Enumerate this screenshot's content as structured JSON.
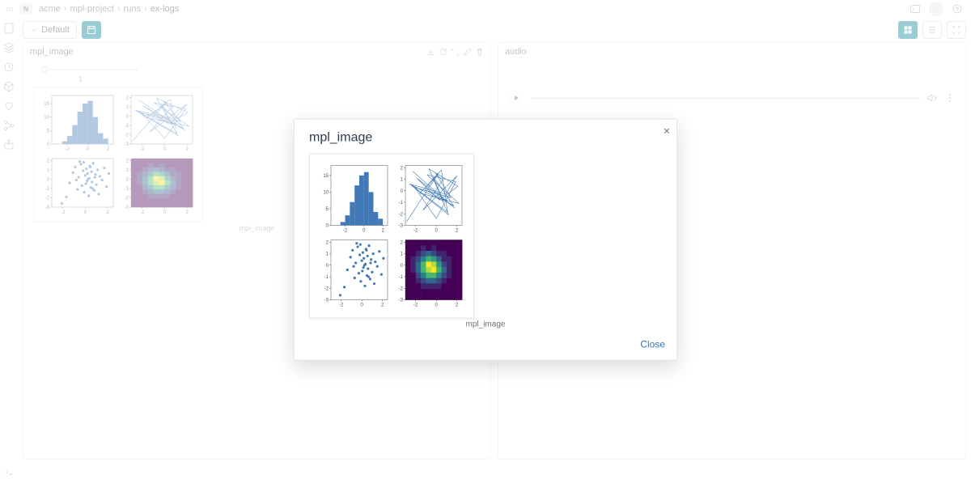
{
  "breadcrumbs": {
    "items": [
      "acme",
      "mpl-project",
      "runs"
    ],
    "current": "ex-logs",
    "badge": "N"
  },
  "toolbar": {
    "default_label": "Default"
  },
  "panels": {
    "left": {
      "title": "mpl_image",
      "caption": "mpl_image",
      "slider_tick": "1"
    },
    "right": {
      "title": "audio"
    }
  },
  "modal": {
    "title": "mpl_image",
    "caption": "mpl_image",
    "close_label": "Close"
  },
  "chart_data": [
    {
      "type": "bar",
      "title": "",
      "xlabel": "",
      "ylabel": "",
      "categories": [
        -3,
        -2.5,
        -2,
        -1.5,
        -1,
        -0.5,
        0,
        0.5,
        1,
        1.5,
        2
      ],
      "values": [
        0,
        1,
        3,
        7,
        12,
        15,
        16,
        10,
        4,
        2,
        0
      ],
      "xlim": [
        -3.5,
        2.5
      ],
      "ylim": [
        0,
        18
      ],
      "yticks": [
        0,
        5,
        10,
        15
      ],
      "xticks": [
        -2,
        0,
        2
      ]
    },
    {
      "type": "line",
      "title": "",
      "xlabel": "",
      "ylabel": "",
      "xlim": [
        -3,
        2.5
      ],
      "ylim": [
        -3,
        2.2
      ],
      "xticks": [
        -2,
        0,
        2
      ],
      "yticks": [
        -3,
        -2,
        -1,
        0,
        1,
        2
      ],
      "series": [
        {
          "name": "walk",
          "x": [
            -2.3,
            -0.4,
            1.8,
            -1.9,
            0.3,
            2.1,
            -0.7,
            1.2,
            -2.6,
            0.9,
            2.0,
            -1.3,
            0.6,
            -0.1,
            1.4,
            -2.1,
            0.0,
            1.9,
            -0.9,
            2.2,
            -1.6,
            0.5,
            1.1,
            -2.4,
            0.7,
            -0.3,
            1.7,
            -1.1,
            0.2,
            -2.9
          ],
          "y": [
            1.7,
            0.2,
            -1.5,
            1.1,
            -0.8,
            0.4,
            1.9,
            -2.1,
            0.6,
            -0.3,
            1.3,
            -1.7,
            0.9,
            1.6,
            -0.6,
            0.3,
            -2.4,
            0.8,
            1.4,
            -1.1,
            -0.2,
            1.8,
            -1.9,
            0.5,
            -0.9,
            1.2,
            -1.3,
            0.1,
            1.5,
            -2.7
          ]
        }
      ]
    },
    {
      "type": "scatter",
      "title": "",
      "xlabel": "",
      "ylabel": "",
      "xlim": [
        -3,
        2.5
      ],
      "ylim": [
        -3,
        2.2
      ],
      "xticks": [
        -2,
        0,
        2
      ],
      "yticks": [
        -3,
        -2,
        -1,
        0,
        1,
        2
      ],
      "series": [
        {
          "name": "pts",
          "x": [
            -2.1,
            -1.7,
            -1.4,
            -1.1,
            -0.9,
            -0.7,
            -0.6,
            -0.4,
            -0.3,
            -0.2,
            -0.1,
            0.0,
            0.1,
            0.15,
            0.2,
            0.3,
            0.35,
            0.4,
            0.5,
            0.55,
            0.6,
            0.7,
            0.8,
            0.9,
            1.0,
            1.1,
            1.2,
            1.3,
            1.5,
            1.7,
            1.9,
            2.1,
            -0.15,
            0.05,
            0.25,
            0.45,
            -0.5,
            -0.8,
            0.65,
            0.85
          ],
          "y": [
            -2.6,
            -1.9,
            -0.4,
            0.7,
            1.3,
            -1.1,
            0.2,
            1.6,
            -0.7,
            0.9,
            -1.4,
            0.4,
            1.1,
            -0.2,
            0.6,
            -1.8,
            0.1,
            1.4,
            -0.9,
            0.8,
            -0.3,
            1.7,
            -1.2,
            0.5,
            -0.6,
            1.0,
            -1.6,
            0.3,
            -0.1,
            1.2,
            -0.8,
            0.6,
            1.8,
            -0.5,
            0.0,
            1.3,
            1.9,
            -0.1,
            -1.0,
            0.2
          ]
        }
      ]
    },
    {
      "type": "heatmap",
      "title": "",
      "xlabel": "",
      "ylabel": "",
      "xlim": [
        -3,
        2.5
      ],
      "ylim": [
        -3,
        2.2
      ],
      "xticks": [
        -2,
        0,
        2
      ],
      "yticks": [
        -3,
        -2,
        -1,
        0,
        1,
        2
      ],
      "grid_size": 11,
      "z": [
        [
          0,
          0,
          0,
          0,
          0,
          0,
          0,
          0,
          0,
          0,
          0
        ],
        [
          0,
          0,
          0,
          1,
          0,
          1,
          0,
          0,
          0,
          0,
          0
        ],
        [
          0,
          0,
          1,
          2,
          3,
          2,
          1,
          1,
          0,
          0,
          0
        ],
        [
          0,
          1,
          2,
          4,
          6,
          5,
          3,
          1,
          1,
          0,
          0
        ],
        [
          0,
          1,
          3,
          6,
          9,
          8,
          5,
          2,
          1,
          0,
          0
        ],
        [
          0,
          1,
          3,
          6,
          8,
          9,
          6,
          3,
          1,
          0,
          0
        ],
        [
          0,
          0,
          2,
          4,
          6,
          6,
          4,
          2,
          1,
          0,
          0
        ],
        [
          0,
          0,
          1,
          2,
          3,
          3,
          2,
          1,
          0,
          0,
          0
        ],
        [
          0,
          0,
          0,
          1,
          1,
          1,
          1,
          0,
          0,
          0,
          0
        ],
        [
          0,
          0,
          0,
          0,
          0,
          0,
          0,
          0,
          0,
          0,
          0
        ],
        [
          0,
          0,
          0,
          0,
          0,
          0,
          0,
          0,
          0,
          0,
          0
        ]
      ],
      "zlim": [
        0,
        9
      ]
    }
  ]
}
